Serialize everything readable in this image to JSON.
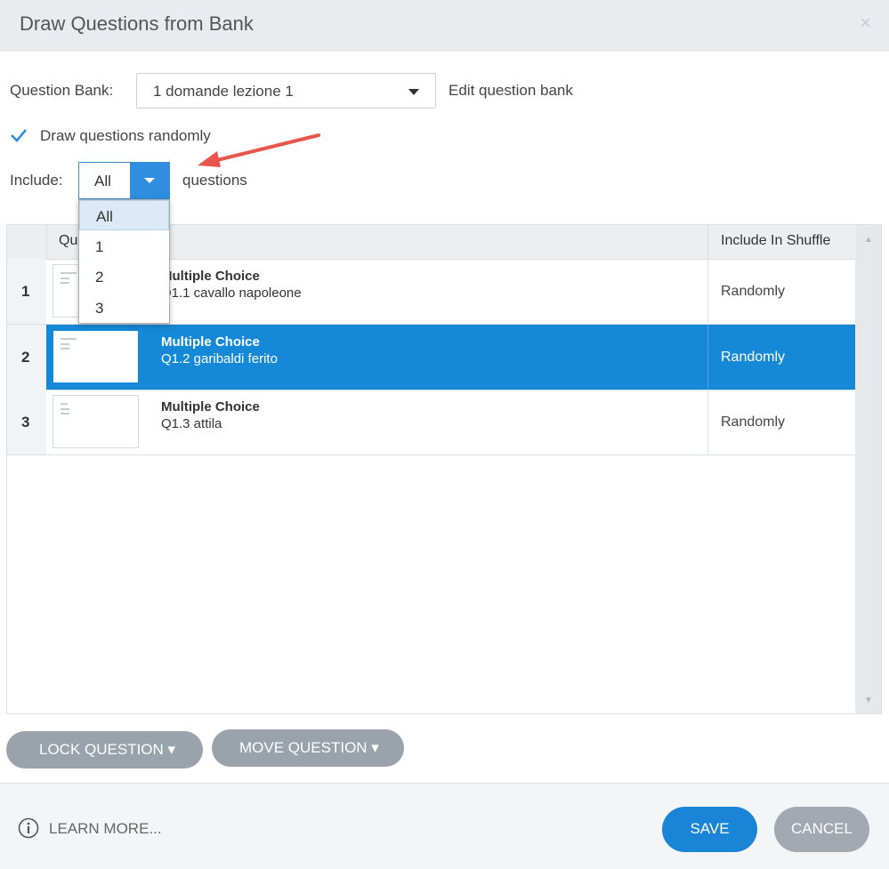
{
  "dialog": {
    "title": "Draw Questions from Bank",
    "close_glyph": "×"
  },
  "bank": {
    "label": "Question Bank:",
    "selected": "1 domande lezione 1",
    "edit_link": "Edit question bank"
  },
  "random": {
    "label": "Draw questions randomly",
    "checked": true
  },
  "include": {
    "label": "Include:",
    "value": "All",
    "suffix": "questions",
    "options": [
      "All",
      "1",
      "2",
      "3"
    ]
  },
  "table": {
    "columns": [
      "Qu",
      "Include In Shuffle"
    ],
    "rows": [
      {
        "num": "1",
        "type": "Multiple Choice",
        "name": "Q1.1 cavallo napoleone",
        "shuffle": "Randomly"
      },
      {
        "num": "2",
        "type": "Multiple Choice",
        "name": "Q1.2 garibaldi ferito",
        "shuffle": "Randomly"
      },
      {
        "num": "3",
        "type": "Multiple Choice",
        "name": "Q1.3 attila",
        "shuffle": "Randomly"
      }
    ],
    "selected_row": 2
  },
  "actions": {
    "lock": "LOCK QUESTION ▾",
    "move": "MOVE QUESTION ▾"
  },
  "footer": {
    "learn_more": "LEARN MORE...",
    "save": "SAVE",
    "cancel": "CANCEL"
  },
  "colors": {
    "accent": "#1588d8",
    "pill": "#9aa2ab",
    "arrow": "#e8564b"
  },
  "icons": [
    "close-icon",
    "check-icon",
    "chevron-down-icon",
    "info-icon",
    "annotation-arrow"
  ]
}
